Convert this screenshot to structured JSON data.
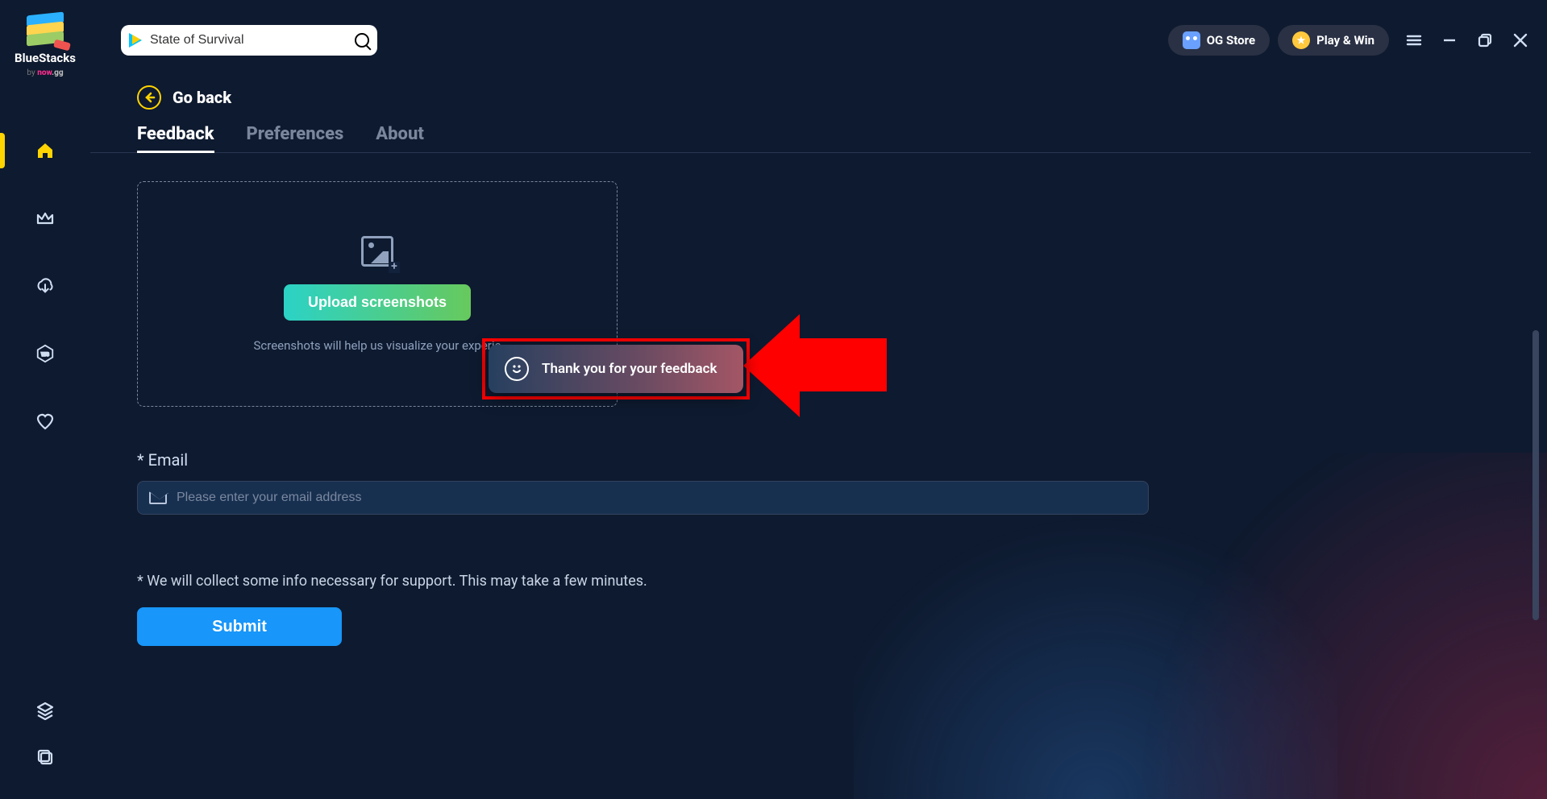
{
  "brand": {
    "name": "BlueStacks",
    "by": "by ",
    "sub1": "now",
    "sub2": ".gg"
  },
  "search": {
    "placeholder": "State of Survival",
    "value": "State of Survival"
  },
  "header_buttons": {
    "og_store": "OG Store",
    "play_win": "Play & Win"
  },
  "go_back": "Go back",
  "tabs": {
    "feedback": "Feedback",
    "preferences": "Preferences",
    "about": "About"
  },
  "upload": {
    "button": "Upload screenshots",
    "helper": "Screenshots will help us visualize your experie"
  },
  "email": {
    "label": "* Email",
    "placeholder": "Please enter your email address"
  },
  "disclaimer": "* We will collect some info necessary for support. This may take a few minutes.",
  "submit": "Submit",
  "toast": "Thank you for your feedback"
}
